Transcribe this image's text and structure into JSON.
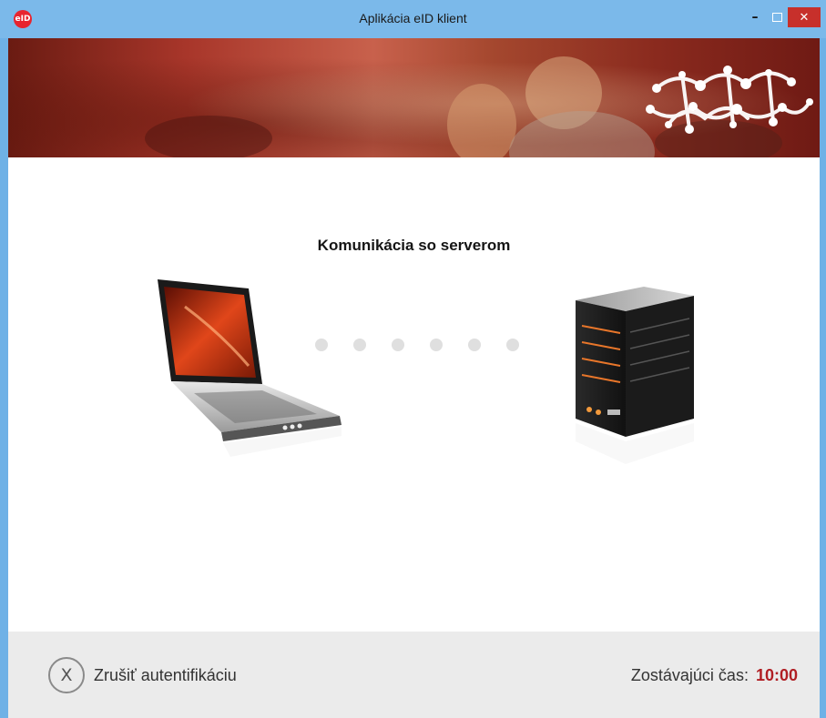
{
  "window": {
    "title": "Aplikácia eID klient",
    "app_icon_text": "eID",
    "minimize_glyph": "–",
    "close_glyph": "✕"
  },
  "main": {
    "title": "Komunikácia so serverom",
    "progress_dots_count": 6
  },
  "footer": {
    "cancel_icon_glyph": "X",
    "cancel_label": "Zrušiť autentifikáciu",
    "timer_label": "Zostávajúci čas:",
    "timer_value": "10:00"
  },
  "colors": {
    "titlebar": "#7bb9ea",
    "close_button": "#c7302b",
    "timer_value": "#b01e23",
    "footer_bg": "#ebebeb",
    "dot": "#dfdfdf"
  },
  "icons": {
    "app": "eid-logo-icon",
    "client": "laptop-icon",
    "server": "server-icon",
    "cancel": "close-circle-icon"
  }
}
